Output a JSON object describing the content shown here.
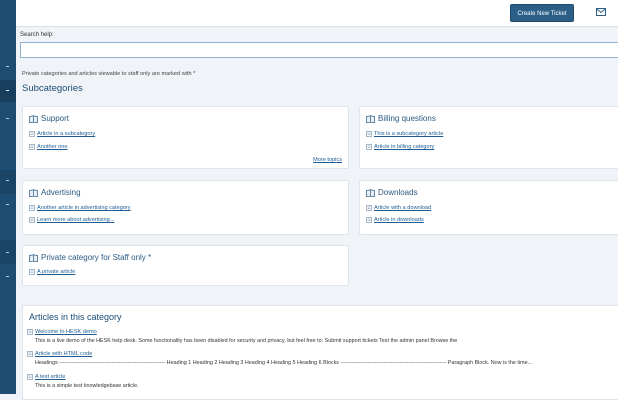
{
  "header": {
    "create_ticket_label": "Create New Ticket",
    "mail_icon": "mail-icon"
  },
  "search": {
    "label": "Search help:",
    "value": "",
    "placeholder": ""
  },
  "notice": "Private categories and articles viewable to staff only are marked with *",
  "subcategories_title": "Subcategories",
  "categories": [
    {
      "title": "Support",
      "articles": [
        "Article in a subcategory",
        "Another one"
      ],
      "more_label": "More topics"
    },
    {
      "title": "Billing questions",
      "articles": [
        "This is a subcategory article",
        "Article in billing category"
      ]
    },
    {
      "title": "Advertising",
      "articles": [
        "Another article in advertising category",
        "Learn more about advertising..."
      ]
    },
    {
      "title": "Downloads",
      "articles": [
        "Article with a download",
        "Article in downloads"
      ]
    },
    {
      "title": "Private category for Staff only *",
      "articles": [
        "A private article"
      ]
    }
  ],
  "articles_section": {
    "title": "Articles in this category",
    "items": [
      {
        "title": "Welcome to HESK demo",
        "excerpt": "This is a live demo of the HESK help desk. Some functionality has been disabled for security and privacy, but feel free to: Submit support tickets Test the admin panel Browse the"
      },
      {
        "title": "Article with HTML code",
        "excerpt": "Headings ----------------------------------------------------------- Heading 1 Heading 2 Heading 3 Heading 4 Heading 5 Heading 6 Blocks ----------------------------------------------------------- Paragraph Block. Now is the time..."
      },
      {
        "title": "A test article",
        "excerpt": "This is a simple test knowledgebase article."
      }
    ]
  },
  "colors": {
    "sidebar": "#1d4d73",
    "primary_button": "#2c5f87",
    "link": "#1f5c93",
    "background": "#f0f4f8"
  }
}
